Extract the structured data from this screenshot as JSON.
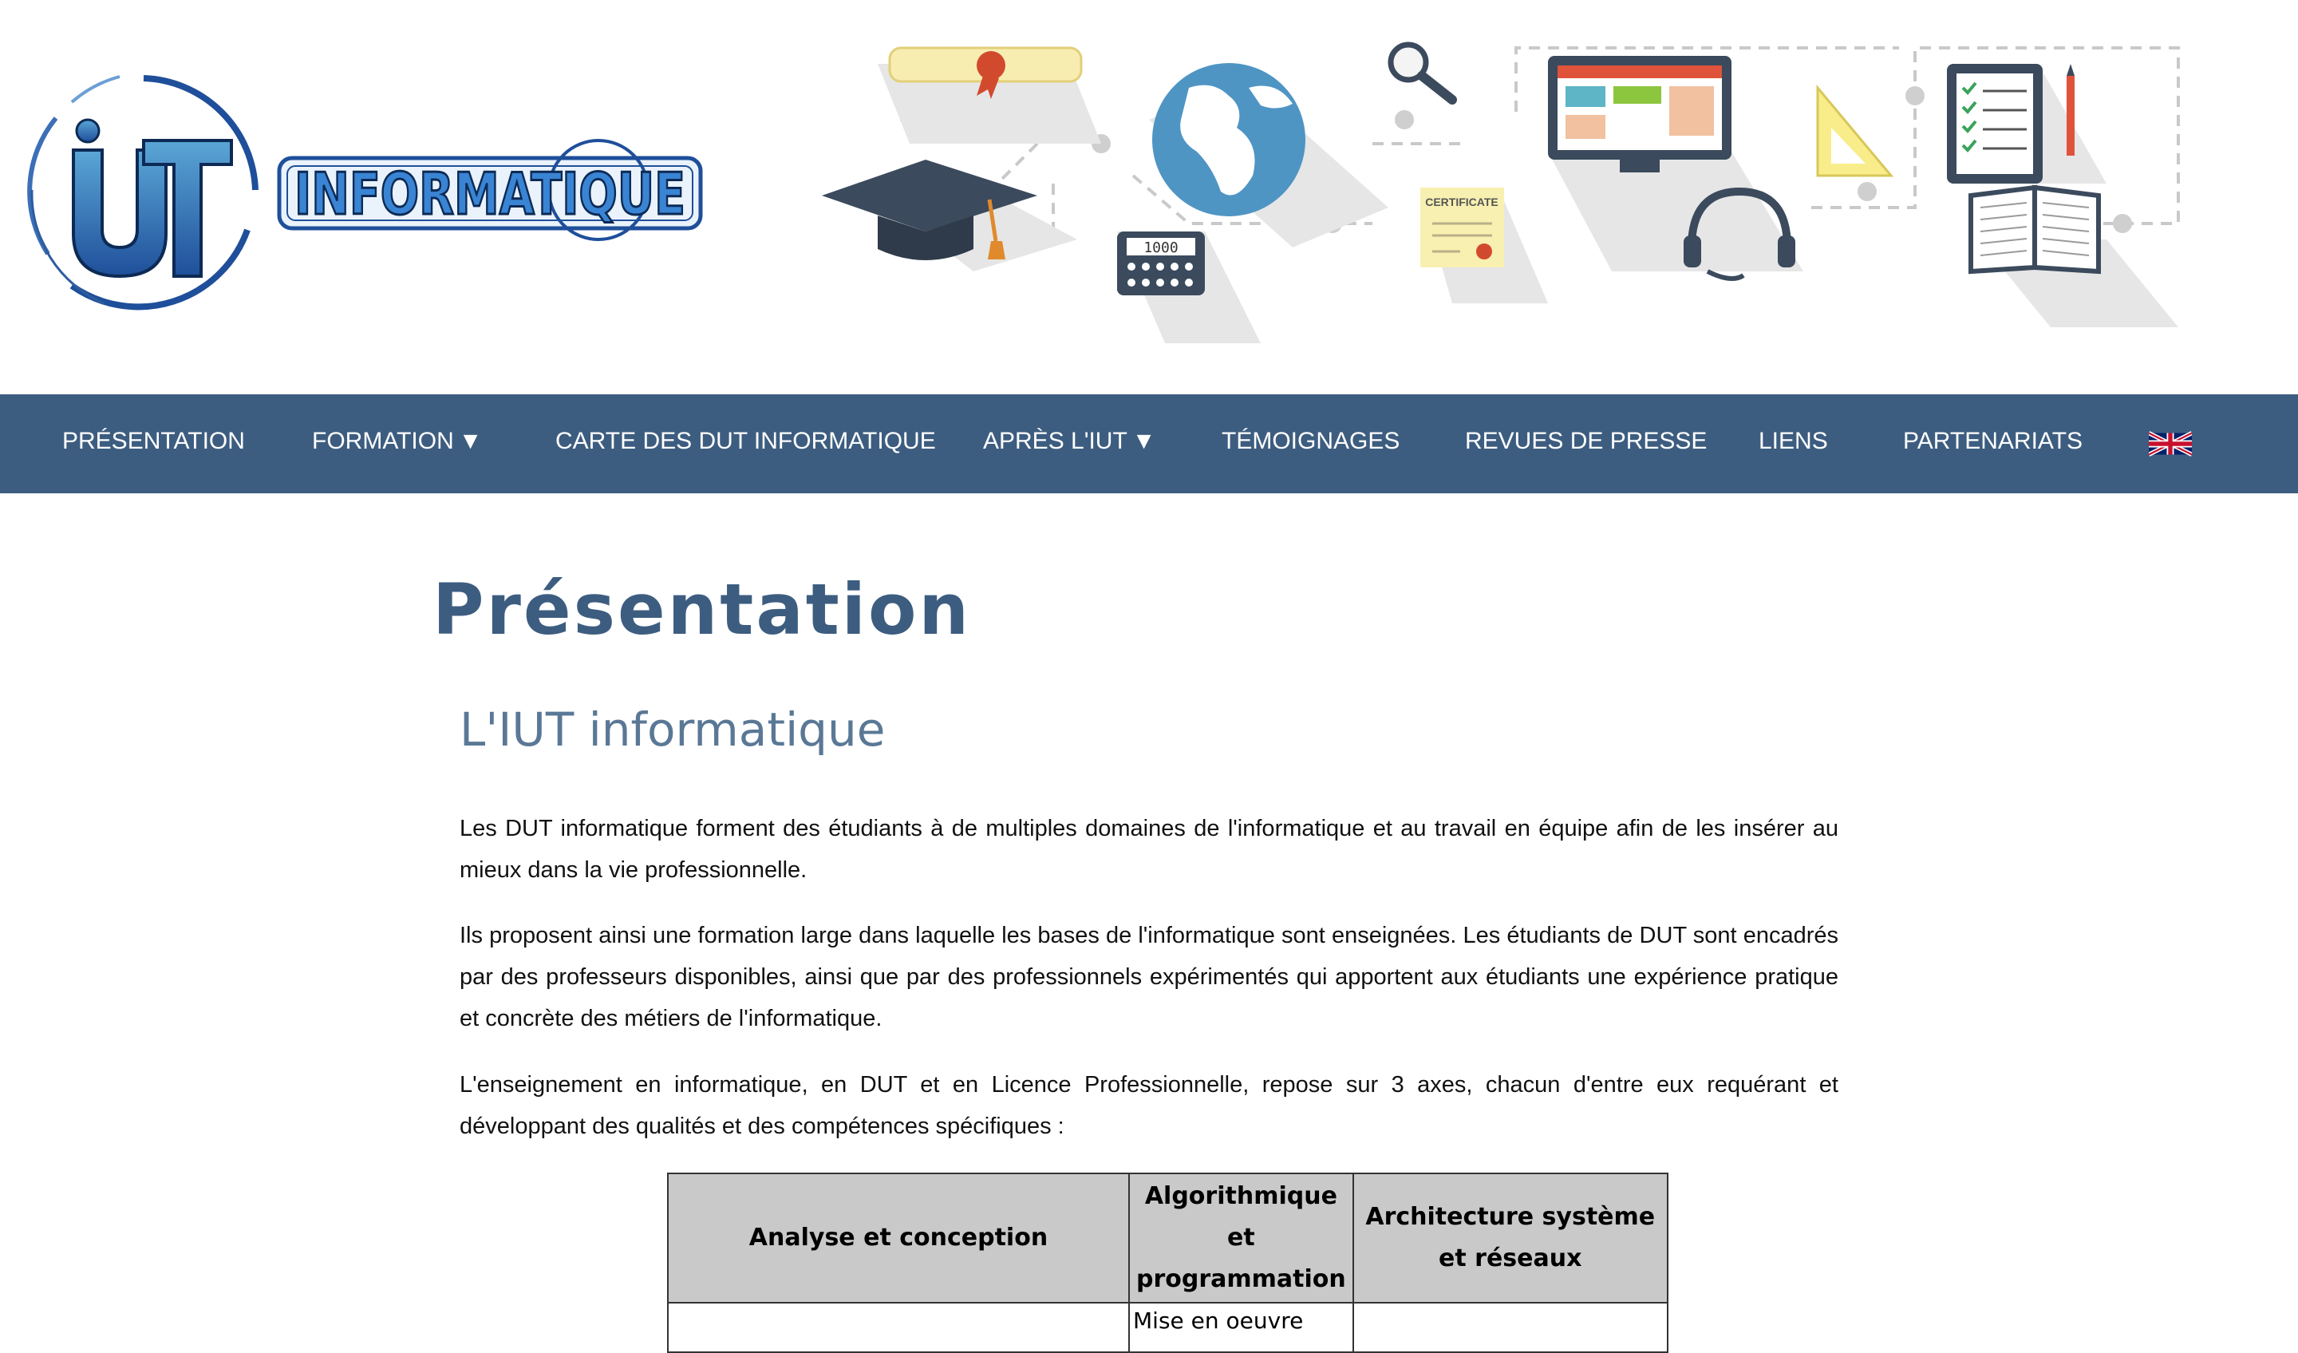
{
  "nav": {
    "items": [
      {
        "label": "PRÉSENTATION"
      },
      {
        "label": "FORMATION",
        "caret": "▼"
      },
      {
        "label": "CARTE DES DUT INFORMATIQUE"
      },
      {
        "label": "APRÈS L'IUT",
        "caret": "▼"
      },
      {
        "label": "TÉMOIGNAGES"
      },
      {
        "label": "REVUES DE PRESSE"
      },
      {
        "label": "LIENS"
      },
      {
        "label": "PARTENARIATS"
      }
    ],
    "language_icon": "uk-flag-icon",
    "background": "#3d5d80"
  },
  "logo": {
    "mark": "iUT",
    "word": "INFORMATIQUE"
  },
  "banner": {
    "icons": [
      "diploma-icon",
      "graduation-cap-icon",
      "calculator-icon",
      "globe-icon",
      "magnifier-icon",
      "certificate-icon",
      "monitor-icon",
      "headset-icon",
      "set-square-icon",
      "clipboard-icon",
      "pencil-icon",
      "book-icon"
    ],
    "calculator_display": "1000",
    "certificate_text": "CERTIFICATE"
  },
  "main": {
    "title": "Présentation",
    "section_title": "L'IUT informatique",
    "paragraphs": [
      "Les DUT informatique forment des étudiants à de multiples domaines de l'informatique et au travail en équipe afin de les insérer au mieux dans la vie professionnelle.",
      "Ils proposent ainsi une formation large dans laquelle les bases de l'informatique sont enseignées. Les étudiants de DUT sont encadrés par des professeurs disponibles, ainsi que par des professionnels expérimentés qui apportent aux étudiants une expérience pratique et concrète des métiers de l'informatique.",
      "L'enseignement en informatique, en DUT et en Licence Professionnelle, repose sur 3 axes, chacun d'entre eux requérant et développant des qualités et des compétences spécifiques :"
    ]
  },
  "table": {
    "headers": [
      "Analyse et conception",
      "Algorithmique et programmation",
      "Architecture système et réseaux"
    ],
    "rows": [
      [
        "",
        "Mise en oeuvre",
        ""
      ]
    ]
  },
  "colors": {
    "primary": "#3d5d80",
    "subtitle": "#5a7896",
    "table_header": "#c9c9c9"
  }
}
